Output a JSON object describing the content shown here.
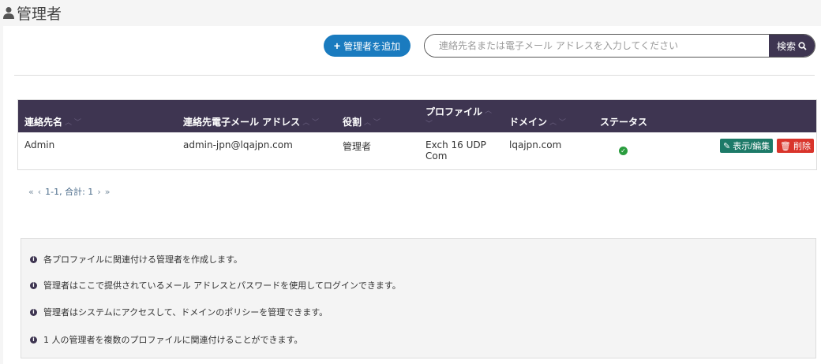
{
  "header": {
    "title": "管理者",
    "icon": "user-icon"
  },
  "toolbar": {
    "add_label": "管理者を追加",
    "search_placeholder": "連絡先名または電子メール アドレスを入力してください",
    "search_label": "検索"
  },
  "table": {
    "columns": [
      "連絡先名",
      "連絡先電子メール アドレス",
      "役割",
      "プロファイル",
      "ドメイン",
      "ステータス"
    ],
    "rows": [
      {
        "name": "Admin",
        "email": "admin-jpn@lqajpn.com",
        "role": "管理者",
        "profile": "Exch 16 UDP Com",
        "domain": "lqajpn.com",
        "status": "active",
        "edit_label": "表示/編集",
        "delete_label": "削除"
      }
    ]
  },
  "pager": {
    "first": "«",
    "prev": "‹",
    "range": "1-1, 合計: 1",
    "next": "›",
    "last": "»"
  },
  "info": [
    "各プロファイルに関連付ける管理者を作成します。",
    "管理者はここで提供されているメール アドレスとパスワードを使用してログインできます。",
    "管理者はシステムにアクセスして、ドメインのポリシーを管理できます。",
    "1 人の管理者を複数のプロファイルに関連付けることができます。"
  ],
  "colors": {
    "header_bg": "#3e3551",
    "add_button": "#1a7bbf",
    "edit_button": "#1d7a68",
    "delete_button": "#d9342b",
    "status_ok": "#2a9d3e"
  }
}
